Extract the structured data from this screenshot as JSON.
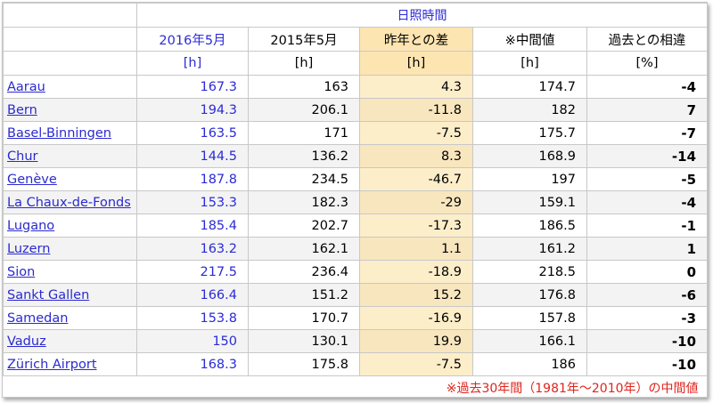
{
  "table": {
    "group_title": "日照時間",
    "headers": [
      "2016年5月",
      "2015年5月",
      "昨年との差",
      "※中間値",
      "過去との相違"
    ],
    "units": [
      "[h]",
      "[h]",
      "[h]",
      "[h]",
      "[%]"
    ],
    "rows": [
      {
        "name": "Aarau",
        "y2016": "167.3",
        "y2015": "163",
        "diff": "4.3",
        "median": "174.7",
        "pct": "-4"
      },
      {
        "name": "Bern",
        "y2016": "194.3",
        "y2015": "206.1",
        "diff": "-11.8",
        "median": "182",
        "pct": "7"
      },
      {
        "name": "Basel-Binningen",
        "y2016": "163.5",
        "y2015": "171",
        "diff": "-7.5",
        "median": "175.7",
        "pct": "-7"
      },
      {
        "name": "Chur",
        "y2016": "144.5",
        "y2015": "136.2",
        "diff": "8.3",
        "median": "168.9",
        "pct": "-14"
      },
      {
        "name": "Genève",
        "y2016": "187.8",
        "y2015": "234.5",
        "diff": "-46.7",
        "median": "197",
        "pct": "-5"
      },
      {
        "name": "La Chaux-de-Fonds",
        "y2016": "153.3",
        "y2015": "182.3",
        "diff": "-29",
        "median": "159.1",
        "pct": "-4"
      },
      {
        "name": "Lugano",
        "y2016": "185.4",
        "y2015": "202.7",
        "diff": "-17.3",
        "median": "186.5",
        "pct": "-1"
      },
      {
        "name": "Luzern",
        "y2016": "163.2",
        "y2015": "162.1",
        "diff": "1.1",
        "median": "161.2",
        "pct": "1"
      },
      {
        "name": "Sion",
        "y2016": "217.5",
        "y2015": "236.4",
        "diff": "-18.9",
        "median": "218.5",
        "pct": "0"
      },
      {
        "name": "Sankt Gallen",
        "y2016": "166.4",
        "y2015": "151.2",
        "diff": "15.2",
        "median": "176.8",
        "pct": "-6"
      },
      {
        "name": "Samedan",
        "y2016": "153.8",
        "y2015": "170.7",
        "diff": "-16.9",
        "median": "157.8",
        "pct": "-3"
      },
      {
        "name": "Vaduz",
        "y2016": "150",
        "y2015": "130.1",
        "diff": "19.9",
        "median": "166.1",
        "pct": "-10"
      },
      {
        "name": "Zürich Airport",
        "y2016": "168.3",
        "y2015": "175.8",
        "diff": "-7.5",
        "median": "186",
        "pct": "-10"
      }
    ],
    "footnote": "※過去30年間（1981年～2010年）の中間値"
  },
  "colors": {
    "link": "#2a2ad0",
    "highlight": "#fdeeca",
    "footnote": "#e0241c"
  }
}
